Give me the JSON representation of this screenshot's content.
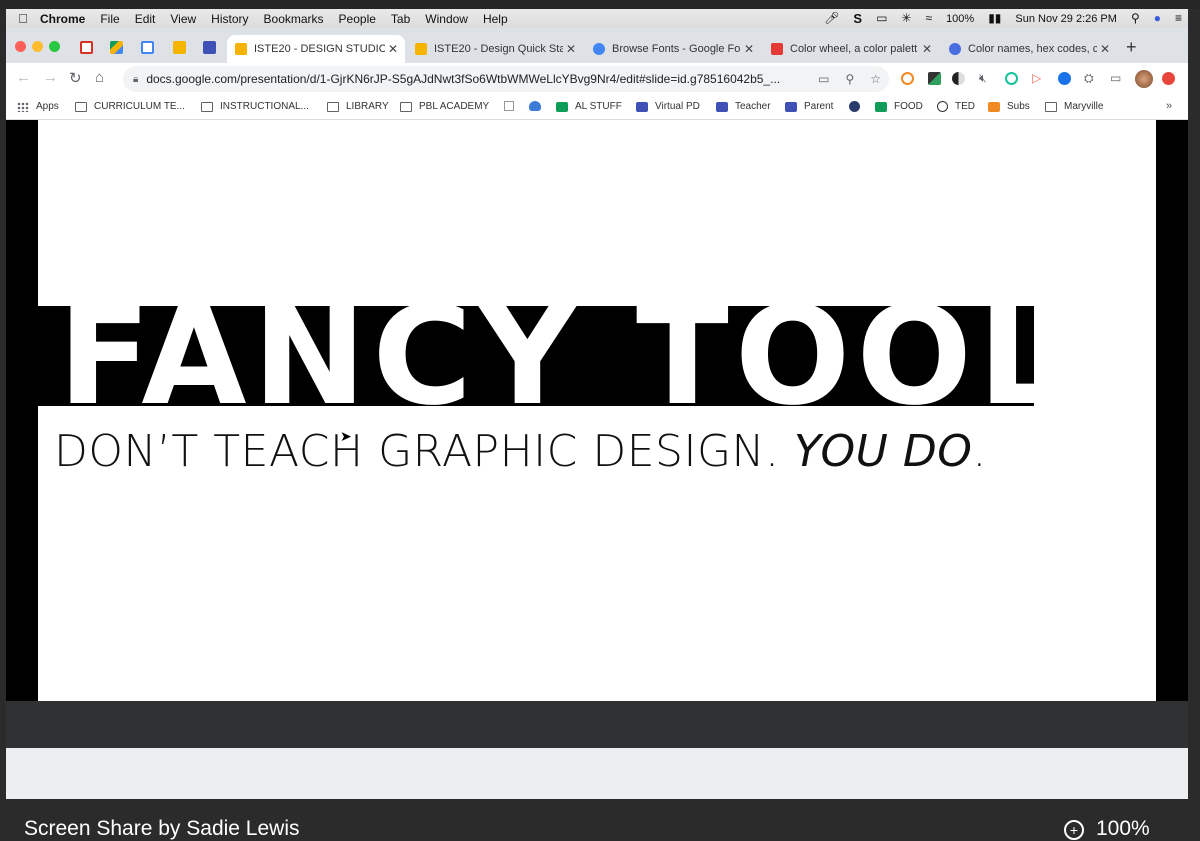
{
  "menubar": {
    "app_name": "Chrome",
    "items": [
      "File",
      "Edit",
      "View",
      "History",
      "Bookmarks",
      "People",
      "Tab",
      "Window",
      "Help"
    ],
    "battery": "100%",
    "datetime": "Sun Nov 29  2:26 PM"
  },
  "tabs": [
    {
      "title": "ISTE20 - DESIGN STUDIO",
      "favicon_color": "#f4b400",
      "active": true
    },
    {
      "title": "ISTE20 - Design Quick Sta",
      "favicon_color": "#f4b400",
      "active": false
    },
    {
      "title": "Browse Fonts - Google Fo",
      "favicon_color": "#4285f4",
      "active": false
    },
    {
      "title": "Color wheel, a color palett",
      "favicon_color": "#e53935",
      "active": false
    },
    {
      "title": "Color names, hex codes, c",
      "favicon_color": "#4a6ee0",
      "active": false
    }
  ],
  "toolbar": {
    "url": "docs.google.com/presentation/d/1-GjrKN6rJP-S5gAJdNwt3fSo6WtbWMWeLlcYBvg9Nr4/edit#slide=id.g78516042b5_..."
  },
  "bookmarks": [
    {
      "label": "Apps",
      "type": "apps"
    },
    {
      "label": "CURRICULUM TE...",
      "type": "folder"
    },
    {
      "label": "INSTRUCTIONAL...",
      "type": "folder"
    },
    {
      "label": "LIBRARY",
      "type": "folder"
    },
    {
      "label": "PBL ACADEMY",
      "type": "folder"
    },
    {
      "label": "",
      "type": "page"
    },
    {
      "label": "",
      "type": "cloud"
    },
    {
      "label": "AL STUFF",
      "type": "sheet"
    },
    {
      "label": "Virtual PD",
      "type": "form"
    },
    {
      "label": "Teacher",
      "type": "form"
    },
    {
      "label": "Parent",
      "type": "form"
    },
    {
      "label": "",
      "type": "m"
    },
    {
      "label": "FOOD",
      "type": "sheet"
    },
    {
      "label": "TED",
      "type": "ted"
    },
    {
      "label": "Subs",
      "type": "subs"
    },
    {
      "label": "Maryville",
      "type": "folder"
    }
  ],
  "slide": {
    "title": "FANCY TOOLS",
    "subtitle_plain": "DON’T TEACH GRAPHIC DESIGN. ",
    "subtitle_italic": "YOU DO",
    "subtitle_end": "."
  },
  "share_bar": {
    "label": "Screen Share by Sadie Lewis",
    "zoom": "100%"
  },
  "colors": {
    "slides_yellow": "#f4b400",
    "tab_strip": "#dee1e6",
    "accent_blue": "#4285f4"
  }
}
